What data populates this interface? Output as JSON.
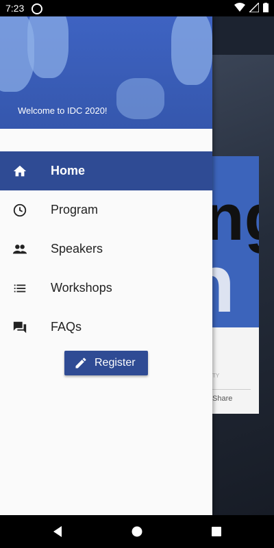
{
  "status_bar": {
    "time": "7:23"
  },
  "drawer": {
    "header": {
      "welcome_text": "Welcome to IDC 2020!"
    },
    "menu_items": [
      {
        "label": "Home",
        "icon": "home-icon",
        "active": true
      },
      {
        "label": "Program",
        "icon": "clock-icon",
        "active": false
      },
      {
        "label": "Speakers",
        "icon": "people-icon",
        "active": false
      },
      {
        "label": "Workshops",
        "icon": "list-icon",
        "active": false
      },
      {
        "label": "FAQs",
        "icon": "chat-icon",
        "active": false
      }
    ],
    "register_button": {
      "label": "Register",
      "icon": "pencil-icon"
    }
  },
  "background_card": {
    "big_text_1": "ng",
    "big_text_2": "n",
    "share_label": "Share",
    "faint_text": "TY"
  },
  "colors": {
    "primary": "#2f4b94",
    "header": "#3e63c2",
    "drawer_bg": "#fafafa"
  },
  "nav_bar": {
    "buttons": [
      "back-icon",
      "home-circle-icon",
      "recents-icon"
    ]
  }
}
